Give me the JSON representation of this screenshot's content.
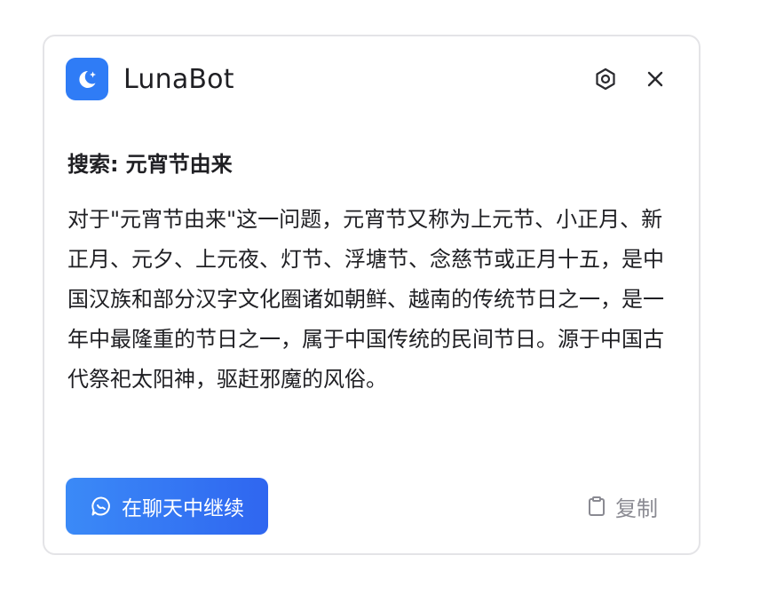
{
  "app": {
    "name": "LunaBot"
  },
  "search": {
    "label": "搜索:",
    "query": "元宵节由来"
  },
  "answer": {
    "text": "对于\"元宵节由来\"这一问题，元宵节又称为上元节、小正月、新正月、元夕、上元夜、灯节、浮塘节、念慈节或正月十五，是中国汉族和部分汉字文化圈诸如朝鲜、越南的传统节日之一，是一年中最隆重的节日之一，属于中国传统的民间节日。源于中国古代祭祀太阳神，驱赶邪魔的风俗。"
  },
  "actions": {
    "continue_label": "在聊天中继续",
    "copy_label": "复制"
  },
  "icons": {
    "logo": "moon-star-icon",
    "settings": "gear-icon",
    "close": "close-icon",
    "chat": "chat-bubble-icon",
    "copy": "clipboard-icon"
  },
  "colors": {
    "accent": "#2f7cf6",
    "button_gradient_start": "#3b8af7",
    "button_gradient_end": "#2f66f0",
    "text": "#1f1f23",
    "muted": "#8a8a92"
  }
}
